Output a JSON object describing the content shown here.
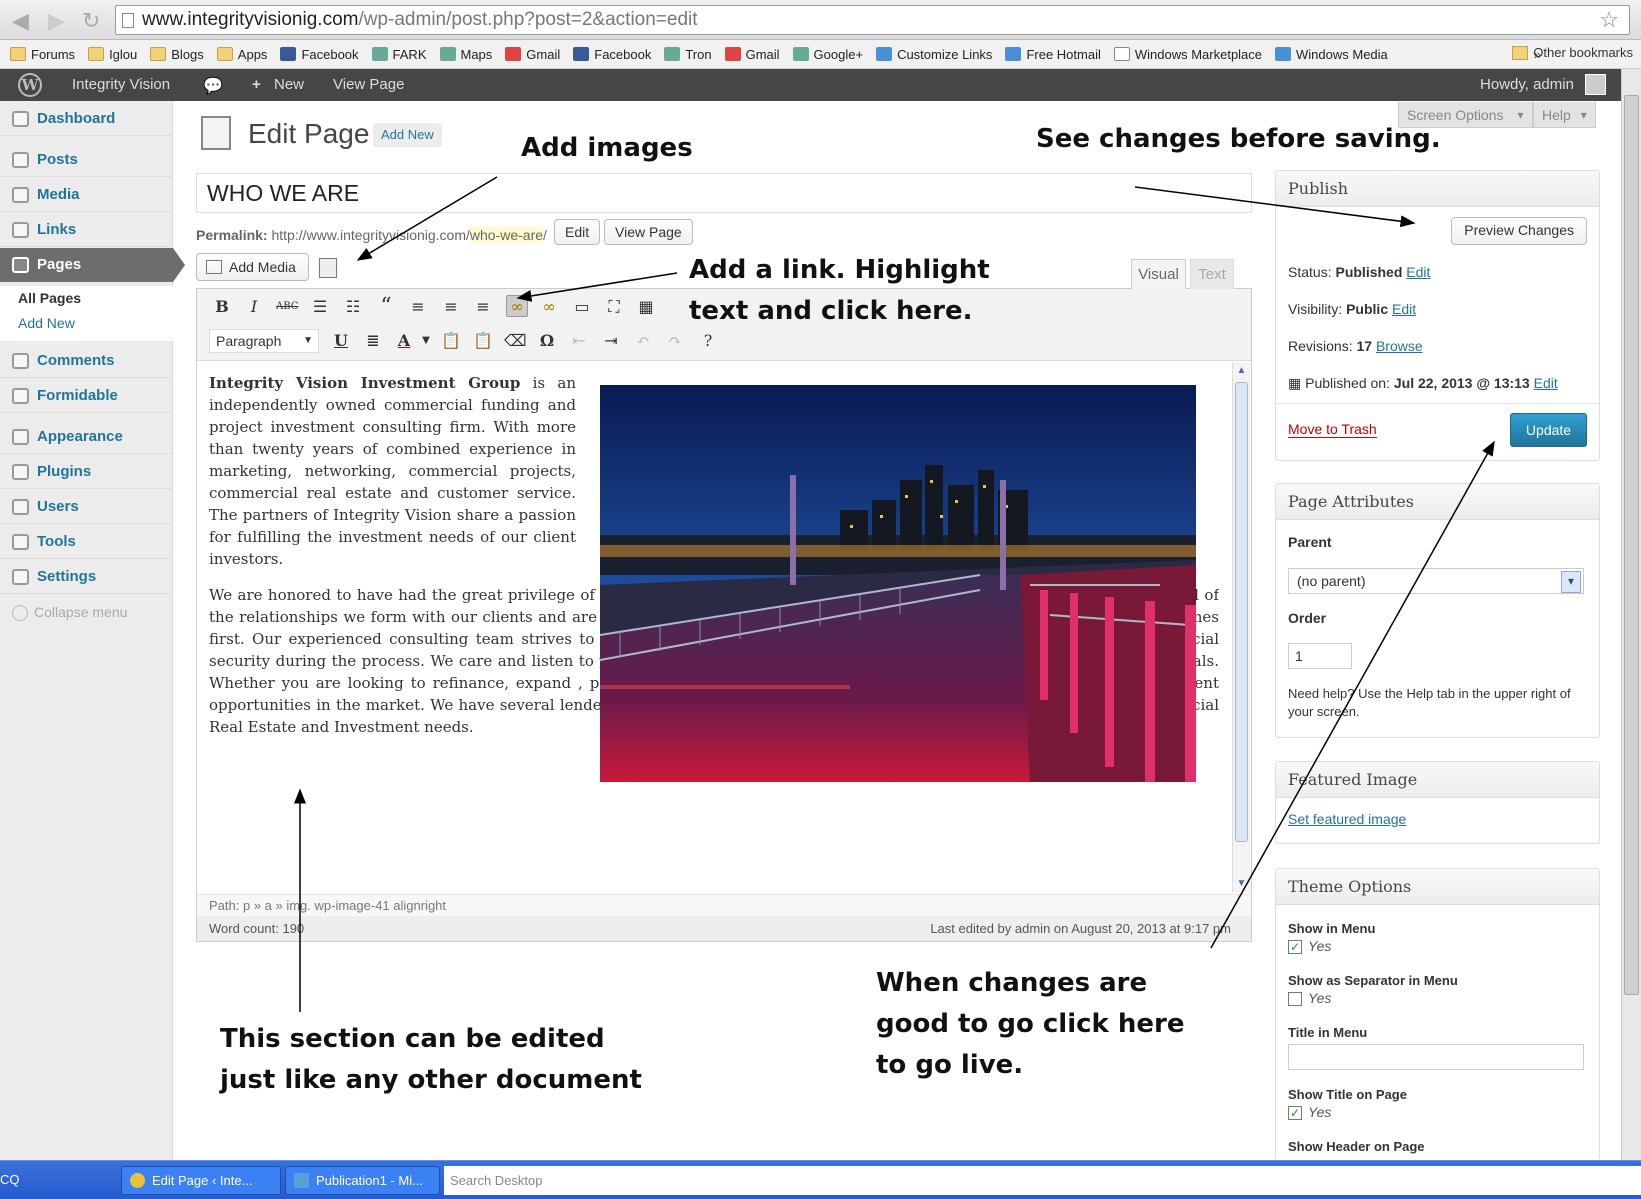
{
  "browser": {
    "url_host": "www.integrityvisionig.com",
    "url_path": "/wp-admin/post.php?post=2&action=edit",
    "bookmarks": [
      "Forums",
      "Iglou",
      "Blogs",
      "Apps",
      "Facebook",
      "FARK",
      "Maps",
      "Gmail",
      "Facebook",
      "Tron",
      "Gmail",
      "Google+",
      "Customize Links",
      "Free Hotmail",
      "Windows Marketplace",
      "Windows Media"
    ],
    "bookmarks_more": "»",
    "other_bookmarks": "Other bookmarks"
  },
  "adminbar": {
    "site_name": "Integrity Vision",
    "new_label": "New",
    "view_page": "View Page",
    "howdy": "Howdy, admin"
  },
  "sidebar": {
    "items": [
      {
        "label": "Dashboard"
      },
      {
        "label": "Posts"
      },
      {
        "label": "Media"
      },
      {
        "label": "Links"
      },
      {
        "label": "Pages"
      },
      {
        "label": "Comments"
      },
      {
        "label": "Formidable"
      },
      {
        "label": "Appearance"
      },
      {
        "label": "Plugins"
      },
      {
        "label": "Users"
      },
      {
        "label": "Tools"
      },
      {
        "label": "Settings"
      }
    ],
    "submenu": {
      "all_pages": "All Pages",
      "add_new": "Add New"
    },
    "collapse": "Collapse menu"
  },
  "header": {
    "title": "Edit Page",
    "add_new": "Add New",
    "screen_options": "Screen Options",
    "help": "Help"
  },
  "post": {
    "title": "WHO WE ARE",
    "permalink_label": "Permalink:",
    "permalink_base": "http://www.integrityvisionig.com/",
    "permalink_slug": "who-we-are",
    "permalink_end": "/",
    "edit_btn": "Edit",
    "view_page_btn": "View Page"
  },
  "editor": {
    "add_media": "Add Media",
    "tab_visual": "Visual",
    "tab_text": "Text",
    "paragraph": "Paragraph",
    "content_bold": "Integrity Vision Investment Group",
    "content_p1": " is an independently owned commercial funding and project investment consulting firm. With more than twenty years of combined experience in marketing, networking, commercial projects, commercial real estate and customer service. The partners of Integrity Vision share a passion for fulfilling the investment needs of our client investors.",
    "content_p2": "We are honored to have had the great privilege of working with a diverse group of clients nationwide and abroad. We are proud of the relationships we form with our clients and are committed to their long-term success. We believe that the client investor comes first. Our experienced consulting team strives to help you, the investor, fulfill your dreams and desires while building financial security during the process. We care and listen to your needs then structure your loan and/or criteria to meet your financial goals. Whether you are looking to refinance, expand , purchase or invest, we have the most innovative loan programs and investment opportunities in the market. We have several lenders each with a multitude of programs that can best fulfill all of your Commercial Real Estate and Investment needs.",
    "path": "Path: p » a » img. wp-image-41 alignright",
    "word_count": "Word count: 190",
    "last_edited": "Last edited by admin on August 20, 2013 at 9:17 pm"
  },
  "publish": {
    "title": "Publish",
    "preview": "Preview Changes",
    "status_label": "Status:",
    "status_value": "Published",
    "visibility_label": "Visibility:",
    "visibility_value": "Public",
    "revisions_label": "Revisions:",
    "revisions_value": "17",
    "browse": "Browse",
    "published_on_label": "Published on:",
    "published_on_value": "Jul 22, 2013 @ 13:13",
    "edit": "Edit",
    "trash": "Move to Trash",
    "update": "Update"
  },
  "page_attributes": {
    "title": "Page Attributes",
    "parent_label": "Parent",
    "parent_value": "(no parent)",
    "order_label": "Order",
    "order_value": "1",
    "help": "Need help? Use the Help tab in the upper right of your screen."
  },
  "featured_image": {
    "title": "Featured Image",
    "link": "Set featured image"
  },
  "theme_options": {
    "title": "Theme Options",
    "show_in_menu": "Show in Menu",
    "show_separator": "Show as Separator in Menu",
    "title_in_menu": "Title in Menu",
    "show_title": "Show Title on Page",
    "show_header": "Show Header on Page",
    "yes": "Yes"
  },
  "annotations": {
    "add_images": "Add images",
    "see_changes": "See changes before saving.",
    "add_link_1": "Add a link. Highlight",
    "add_link_2": "text and click here.",
    "section_edit_1": "This section can be edited",
    "section_edit_2": "just like any other document",
    "go_live_1": "When changes are",
    "go_live_2": "good to go click here",
    "go_live_3": "to go live."
  },
  "taskbar": {
    "icq": "CQ",
    "task1": "Edit Page ‹ Inte...",
    "task2": "Publication1 - Mi...",
    "search": "Search Desktop"
  }
}
